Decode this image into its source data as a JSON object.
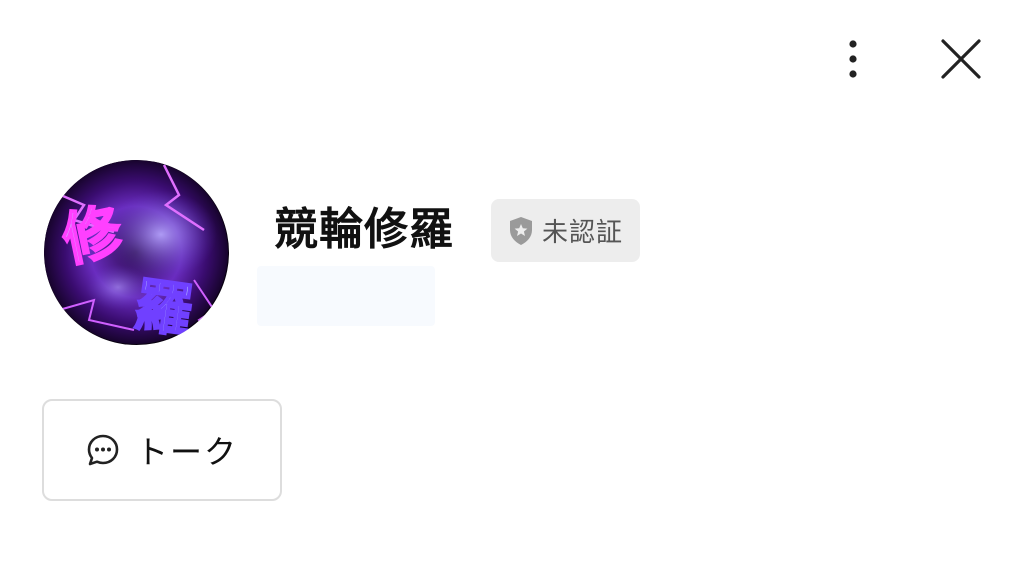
{
  "header": {
    "more_icon": "vertical-ellipsis-icon",
    "close_icon": "close-x-icon"
  },
  "profile": {
    "avatar_icon": "profile-avatar-image",
    "avatar_text": "修羅",
    "name": "競輪修羅",
    "verification_badge": {
      "icon": "shield-star-icon",
      "label": "未認証"
    },
    "status_message": ""
  },
  "actions": {
    "talk": {
      "icon": "chat-bubble-icon",
      "label": "トーク"
    }
  },
  "colors": {
    "text": "#111111",
    "badge_bg": "#ededed",
    "badge_text": "#555555",
    "button_border": "#dddddd",
    "avatar_purple": "#a020f0",
    "avatar_bg": "#0a0010"
  }
}
